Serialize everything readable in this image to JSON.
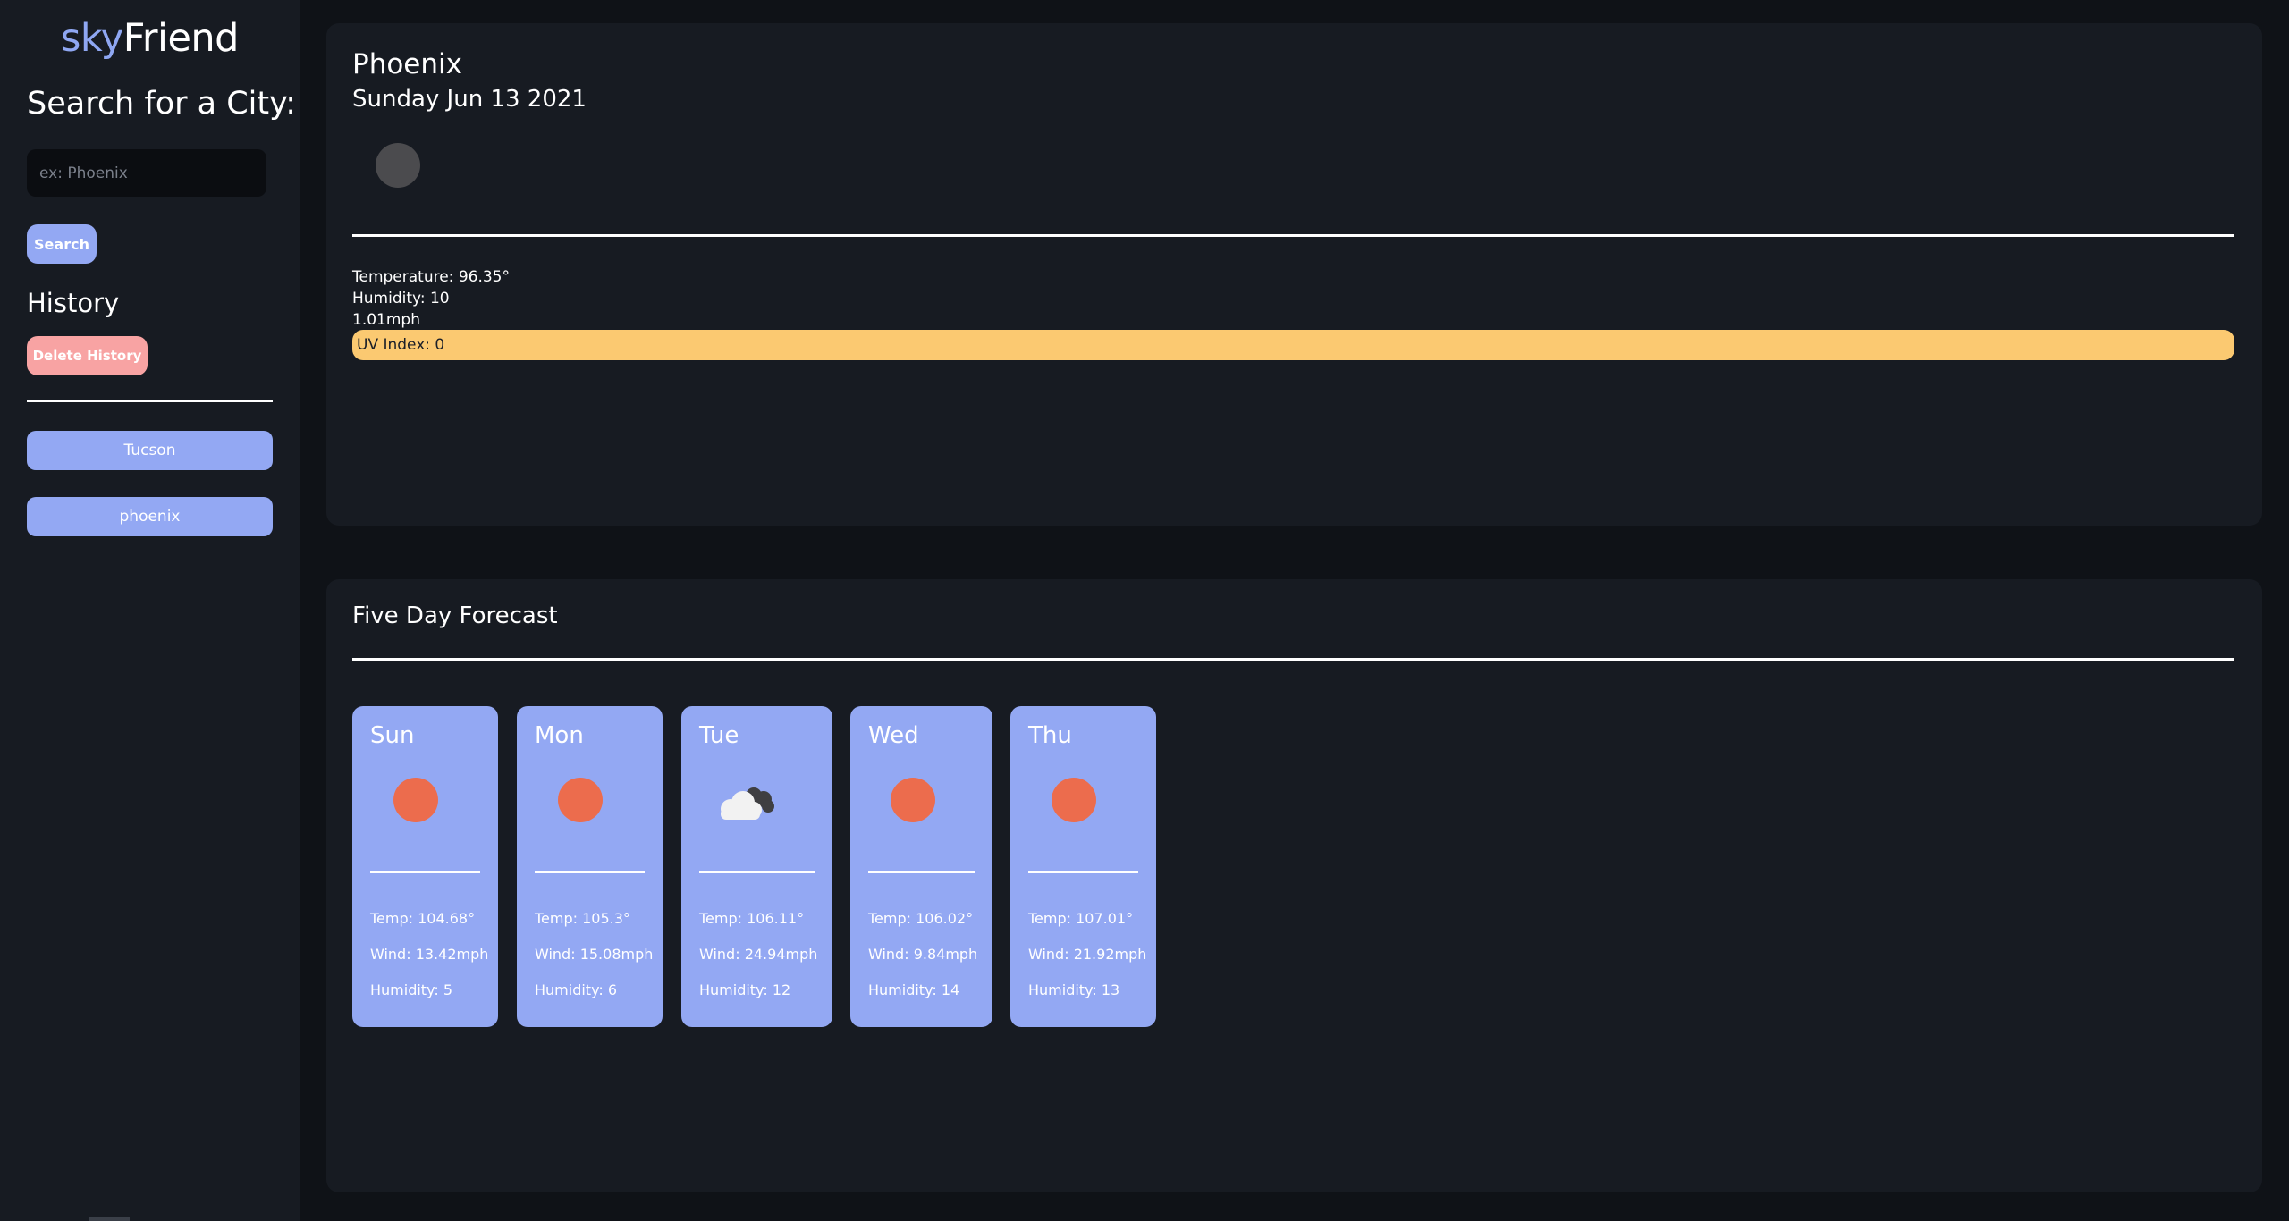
{
  "app": {
    "logo_part1": "sky",
    "logo_part2": "Friend"
  },
  "sidebar": {
    "search_heading": "Search for a City:",
    "search_placeholder": "ex: Phoenix",
    "search_value": "",
    "search_button": "Search",
    "history_heading": "History",
    "delete_history_button": "Delete History",
    "history_items": [
      {
        "label": "Tucson"
      },
      {
        "label": "phoenix"
      }
    ]
  },
  "current": {
    "city": "Phoenix",
    "date": "Sunday Jun 13 2021",
    "icon": "moon-icon",
    "temperature": "Temperature: 96.35°",
    "humidity": "Humidity: 10",
    "wind": "1.01mph",
    "uv_index": "UV Index: 0"
  },
  "forecast": {
    "heading": "Five Day Forecast",
    "days": [
      {
        "day": "Sun",
        "icon": "sun-icon",
        "temp": "Temp: 104.68°",
        "wind": "Wind: 13.42mph",
        "humidity": "Humidity: 5"
      },
      {
        "day": "Mon",
        "icon": "sun-icon",
        "temp": "Temp: 105.3°",
        "wind": "Wind: 15.08mph",
        "humidity": "Humidity: 6"
      },
      {
        "day": "Tue",
        "icon": "cloud-icon",
        "temp": "Temp: 106.11°",
        "wind": "Wind: 24.94mph",
        "humidity": "Humidity: 12"
      },
      {
        "day": "Wed",
        "icon": "sun-icon",
        "temp": "Temp: 106.02°",
        "wind": "Wind: 9.84mph",
        "humidity": "Humidity: 14"
      },
      {
        "day": "Thu",
        "icon": "sun-icon",
        "temp": "Temp: 107.01°",
        "wind": "Wind: 21.92mph",
        "humidity": "Humidity: 13"
      }
    ]
  },
  "colors": {
    "background": "#0f1217",
    "panel": "#171b22",
    "accent": "#93a8f3",
    "logo_accent": "#8fa7f2",
    "delete": "#f8a3a3",
    "uv_bar": "#fbc971",
    "sun": "#ec6c4d",
    "moon": "#4b4b4e"
  }
}
